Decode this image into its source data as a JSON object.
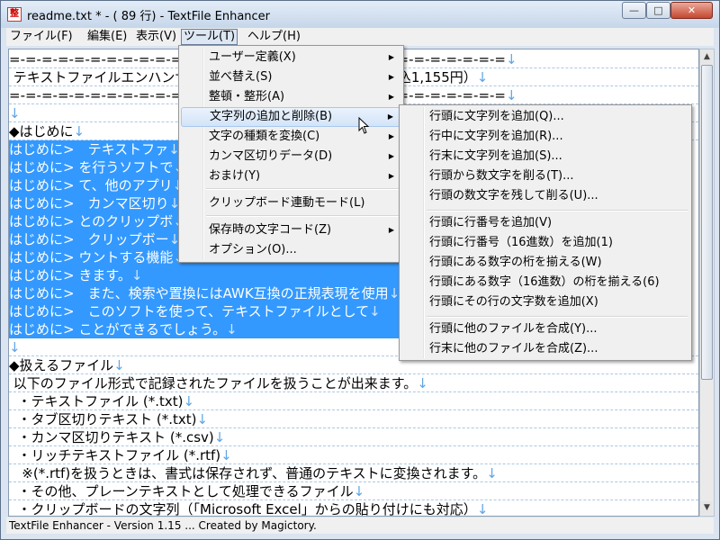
{
  "window": {
    "title": "readme.txt * - ( 89 行) - TextFile Enhancer",
    "icon_glyph": "整",
    "controls": {
      "minimize": "—",
      "maximize": "□",
      "close": "✕"
    }
  },
  "menubar": [
    "ファイル(F)",
    "編集(E)",
    "表示(V)",
    "ツール(T)",
    "ヘルプ(H)"
  ],
  "editor_lines": [
    {
      "text": "=-=-=-=-=-=-=-=-=-=-=-=-=-=-=-=-=-=-=-=-=-=-=-=-=-=-=-=-=-=-=",
      "sel": false
    },
    {
      "text": " テキストファイルエンハンサー　　　　　　　　　　　（手数料込1,155円）",
      "sel": false
    },
    {
      "text": "=-=-=-=-=-=-=-=-=-=-=-=-=-=-=-=-=-=-=-=-=-=-=-=-=-=-=-=-=-=-=",
      "sel": false
    },
    {
      "text": "",
      "sel": false
    },
    {
      "text": "◆はじめに",
      "sel": false
    },
    {
      "text": "はじめに>　テキストファ",
      "sel": true
    },
    {
      "text": "はじめに> を行うソフトで",
      "sel": true
    },
    {
      "text": "はじめに> て、他のアプリ",
      "sel": true
    },
    {
      "text": "はじめに>　カンマ区切り",
      "sel": true
    },
    {
      "text": "はじめに> とのクリップボ",
      "sel": true
    },
    {
      "text": "はじめに>　クリップボー",
      "sel": true
    },
    {
      "text": "はじめに> ウントする機能",
      "sel": true
    },
    {
      "text": "はじめに> きます。",
      "sel": true
    },
    {
      "text": "はじめに>　また、検索や置換にはAWK互換の正規表現を使用",
      "sel": true
    },
    {
      "text": "はじめに>　このソフトを使って、テキストファイルとして",
      "sel": true
    },
    {
      "text": "はじめに> ことができるでしょう。",
      "sel": true
    },
    {
      "text": "",
      "sel": false
    },
    {
      "text": "◆扱えるファイル",
      "sel": false
    },
    {
      "text": " 以下のファイル形式で記録されたファイルを扱うことが出来ます。",
      "sel": false
    },
    {
      "text": "  ・テキストファイル (*.txt)",
      "sel": false
    },
    {
      "text": "  ・タブ区切りテキスト (*.txt)",
      "sel": false
    },
    {
      "text": "  ・カンマ区切りテキスト (*.csv)",
      "sel": false
    },
    {
      "text": "  ・リッチテキストファイル (*.rtf)",
      "sel": false
    },
    {
      "text": "   ※(*.rtf)を扱うときは、書式は保存されず、普通のテキストに変換されます。",
      "sel": false
    },
    {
      "text": "  ・その他、プレーンテキストとして処理できるファイル",
      "sel": false
    },
    {
      "text": "  ・クリップボードの文字列（「Microsoft Excel」からの貼り付けにも対応）",
      "sel": false
    }
  ],
  "eol_glyph": "↓",
  "tool_menu": [
    {
      "label": "ユーザー定義(X)",
      "arrow": "▶"
    },
    {
      "label": "並べ替え(S)",
      "arrow": "▶"
    },
    {
      "label": "整頓・整形(A)",
      "arrow": "▶"
    },
    {
      "label": "文字列の追加と削除(B)",
      "arrow": "▶"
    },
    {
      "label": "文字の種類を変換(C)",
      "arrow": "▶"
    },
    {
      "label": "カンマ区切りデータ(D)",
      "arrow": "▶"
    },
    {
      "label": "おまけ(Y)",
      "arrow": "▶"
    },
    {
      "label": "クリップボード連動モード(L)",
      "arrow": ""
    },
    {
      "label": "保存時の文字コード(Z)",
      "arrow": "▶"
    },
    {
      "label": "オプション(O)...",
      "arrow": ""
    }
  ],
  "submenu": [
    "行頭に文字列を追加(Q)...",
    "行中に文字列を追加(R)...",
    "行末に文字列を追加(S)...",
    "行頭から数文字を削る(T)...",
    "行頭の数文字を残して削る(U)...",
    "行頭に行番号を追加(V)",
    "行頭に行番号（16進数）を追加(1)",
    "行頭にある数字の桁を揃える(W)",
    "行頭にある数字（16進数）の桁を揃える(6)",
    "行頭にその行の文字数を追加(X)",
    "行頭に他のファイルを合成(Y)...",
    "行末に他のファイルを合成(Z)..."
  ],
  "status": "TextFile Enhancer - Version 1.15 ... Created by Magictory.",
  "colors": {
    "selection": "#3399ff",
    "eol_marker": "#5fa5e6",
    "menu_highlight": "#d3e4f8"
  }
}
